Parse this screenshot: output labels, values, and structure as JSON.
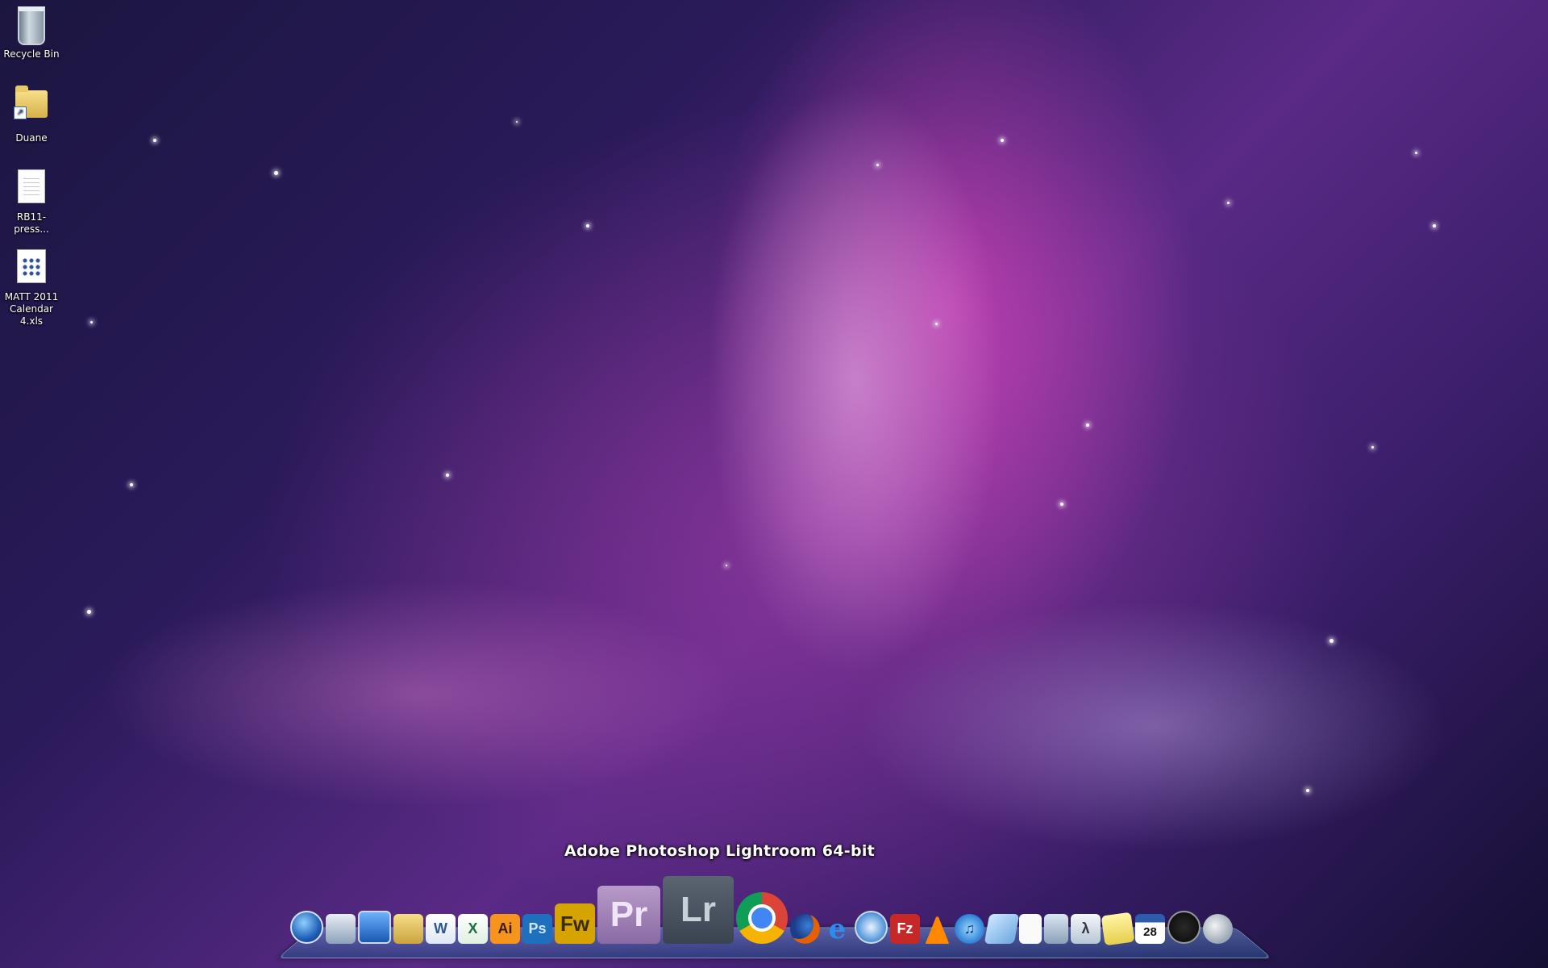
{
  "desktop": {
    "icons": [
      {
        "label": "Recycle Bin",
        "icon": "recycle-bin-icon"
      },
      {
        "label": "Duane",
        "icon": "folder-shortcut-icon"
      },
      {
        "label": "RB11-press...",
        "icon": "text-document-icon"
      },
      {
        "label": "MATT 2011 Calendar 4.xls",
        "icon": "spreadsheet-file-icon"
      }
    ]
  },
  "dock": {
    "tooltip": "Adobe Photoshop Lightroom 64-bit",
    "items": [
      {
        "icon": "windows-start-icon",
        "glyph": ""
      },
      {
        "icon": "paint-app-icon",
        "glyph": ""
      },
      {
        "icon": "computer-monitor-icon",
        "glyph": ""
      },
      {
        "icon": "folder-icon",
        "glyph": ""
      },
      {
        "icon": "word-icon",
        "glyph": "W"
      },
      {
        "icon": "excel-icon",
        "glyph": "X"
      },
      {
        "icon": "illustrator-icon",
        "glyph": "Ai"
      },
      {
        "icon": "photoshop-icon",
        "glyph": "Ps"
      },
      {
        "icon": "fireworks-icon",
        "glyph": "Fw"
      },
      {
        "icon": "premiere-icon",
        "glyph": "Pr"
      },
      {
        "icon": "lightroom-icon",
        "glyph": "Lr"
      },
      {
        "icon": "chrome-icon",
        "glyph": ""
      },
      {
        "icon": "firefox-icon",
        "glyph": ""
      },
      {
        "icon": "internet-explorer-icon",
        "glyph": "e"
      },
      {
        "icon": "safari-icon",
        "glyph": ""
      },
      {
        "icon": "filezilla-icon",
        "glyph": "Fz"
      },
      {
        "icon": "vlc-icon",
        "glyph": ""
      },
      {
        "icon": "itunes-icon",
        "glyph": "♫"
      },
      {
        "icon": "notepad-icon",
        "glyph": ""
      },
      {
        "icon": "blank-document-icon",
        "glyph": ""
      },
      {
        "icon": "calculator-icon",
        "glyph": ""
      },
      {
        "icon": "math-input-icon",
        "glyph": "λ"
      },
      {
        "icon": "sticky-notes-icon",
        "glyph": ""
      },
      {
        "icon": "calendar-icon",
        "glyph": "28"
      },
      {
        "icon": "clock-icon",
        "glyph": ""
      },
      {
        "icon": "weather-icon",
        "glyph": ""
      }
    ],
    "colors": {
      "illustrator": "#f7941d",
      "photoshop": "#1f6fbf",
      "fireworks": "#d6a400",
      "premiere": "#9b7bb3",
      "lightroom": "#4a5563",
      "filezilla": "#c62828"
    }
  }
}
